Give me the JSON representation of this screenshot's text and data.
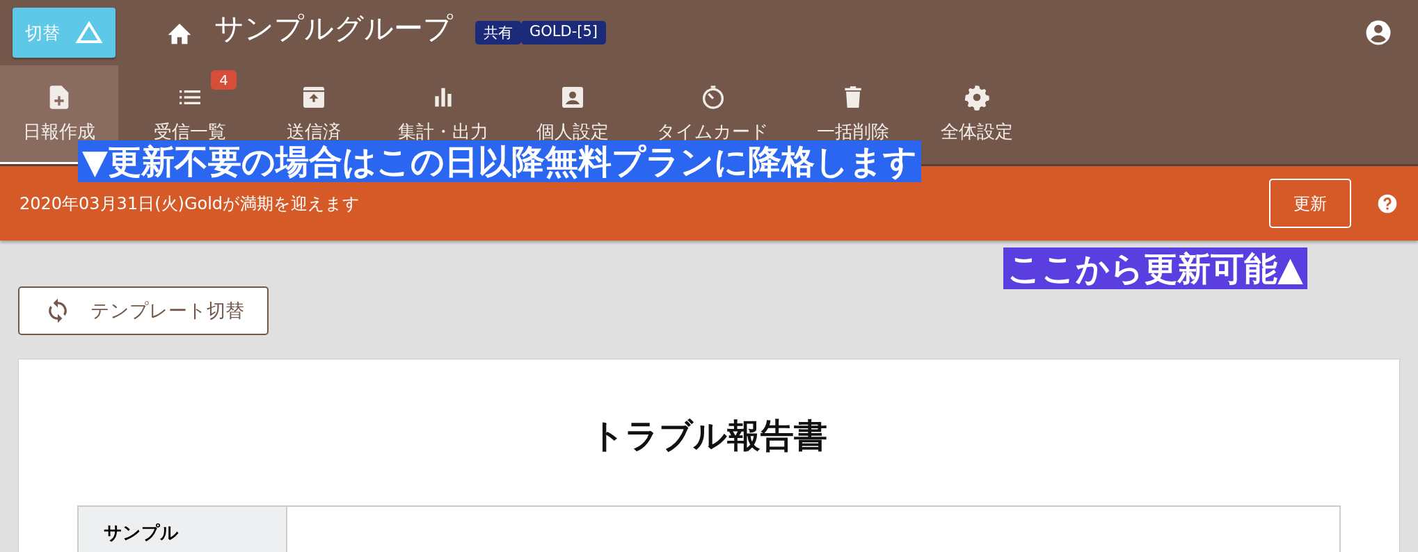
{
  "header": {
    "switch_button": "切替",
    "group_name": "サンプルグループ",
    "tags": [
      "共有",
      "GOLD-[5]"
    ]
  },
  "nav": [
    {
      "label": "日報作成",
      "kind": "new-file",
      "selected": true
    },
    {
      "label": "受信一覧",
      "kind": "list",
      "selected": false,
      "badge": "4"
    },
    {
      "label": "送信済",
      "kind": "outbox",
      "selected": false
    },
    {
      "label": "集計・出力",
      "kind": "chart",
      "selected": false
    },
    {
      "label": "個人設定",
      "kind": "person",
      "selected": false
    },
    {
      "label": "タイムカード",
      "kind": "timer",
      "selected": false
    },
    {
      "label": "一括削除",
      "kind": "trash",
      "selected": false
    },
    {
      "label": "全体設定",
      "kind": "gear",
      "selected": false
    }
  ],
  "notice": {
    "message": "2020年03月31日(火)Goldが満期を迎えます",
    "renew_button": "更新"
  },
  "callouts": [
    {
      "text": "▼更新不要の場合はこの日以降無料プランに降格します",
      "color": "#2a66f0"
    },
    {
      "text": "ここから更新可能▲",
      "color": "#5a3ee0"
    }
  ],
  "template_button": "テンプレート切替",
  "report": {
    "title": "トラブル報告書",
    "rows": [
      {
        "label": "サンプル"
      }
    ]
  }
}
